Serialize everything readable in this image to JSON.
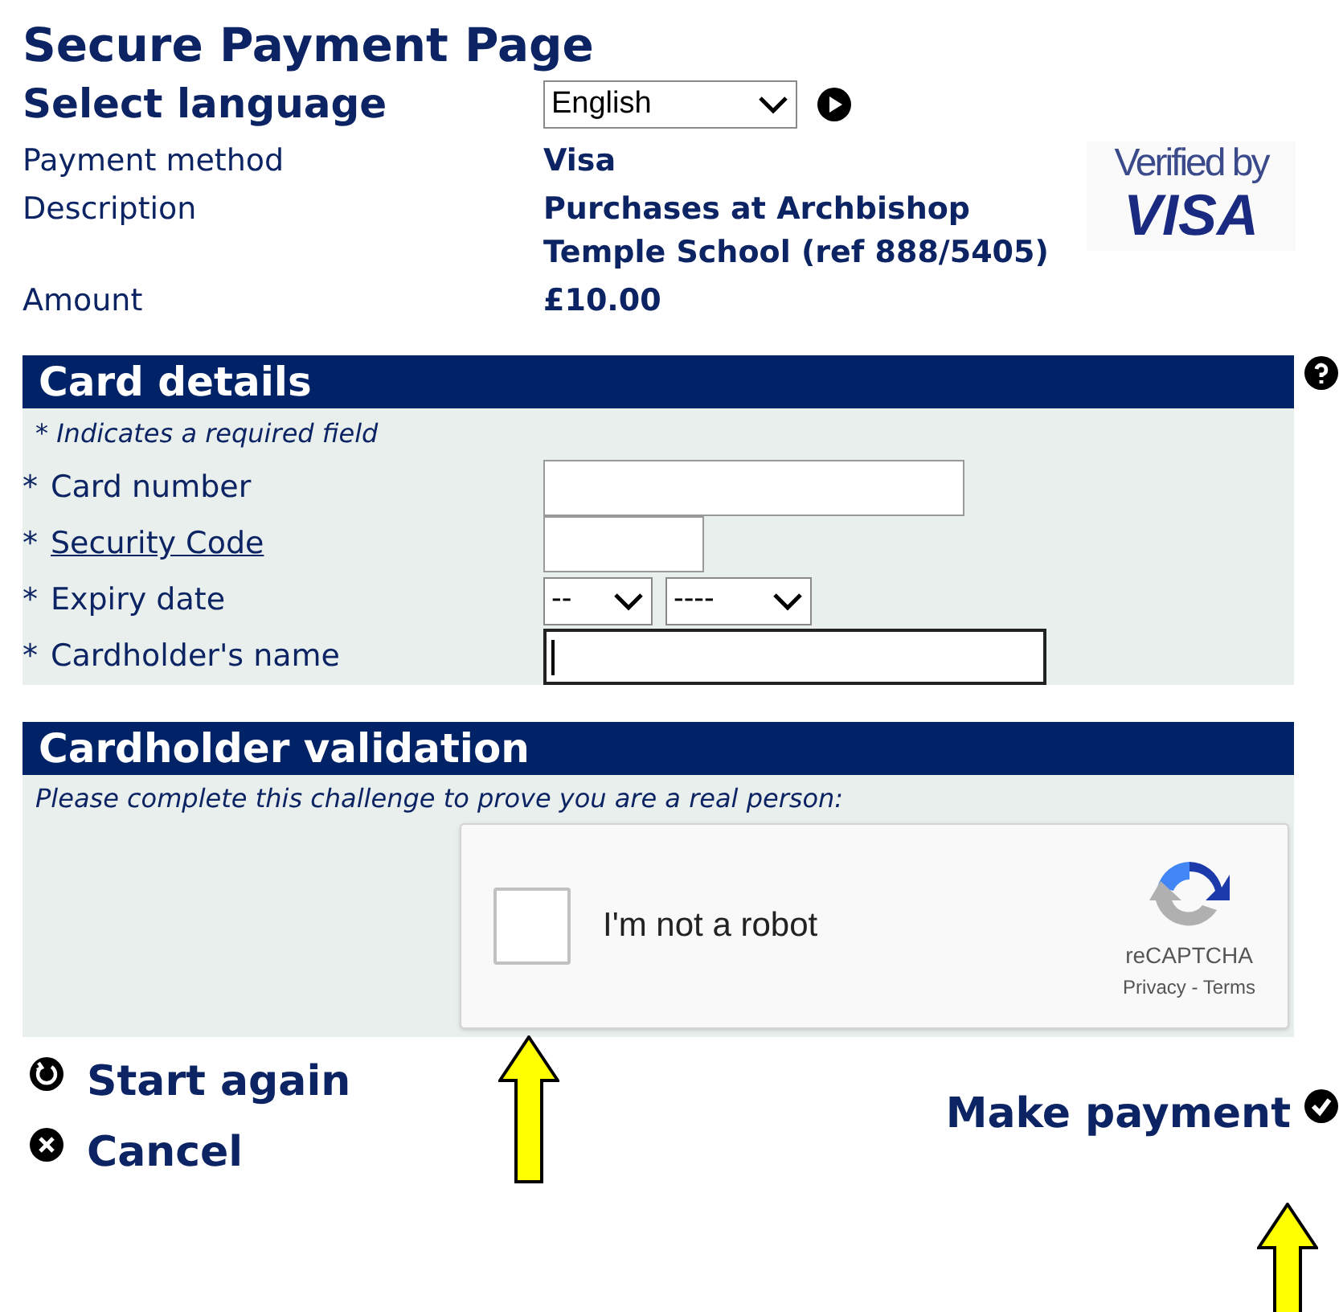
{
  "title": "Secure Payment Page",
  "language": {
    "label": "Select language",
    "value": "English"
  },
  "summary": [
    {
      "label": "Payment method",
      "value": "Visa"
    },
    {
      "label": "Description",
      "value": "Purchases at Archbishop Temple School (ref 888/5405)"
    },
    {
      "label": "Amount",
      "value": "£10.00"
    }
  ],
  "logo": {
    "line1": "Verified by",
    "line2": "VISA"
  },
  "card_details": {
    "title": "Card details",
    "note": "* Indicates a required field",
    "fields": [
      {
        "kind": "number",
        "marker": "*",
        "label": "Card number",
        "link": false,
        "focused": false
      },
      {
        "kind": "code",
        "marker": "*",
        "label": "Security Code",
        "link": true,
        "focused": false
      },
      {
        "kind": "expiry",
        "marker": "*",
        "label": "Expiry date",
        "link": false,
        "month": "--",
        "year": "----"
      },
      {
        "kind": "name",
        "marker": "*",
        "label": "Cardholder's name",
        "link": false,
        "focused": true
      }
    ]
  },
  "validation": {
    "title": "Cardholder validation",
    "note": "Please complete this challenge to prove you are a real person:",
    "captcha": {
      "label": "I'm not a robot",
      "checked": false,
      "brand": "reCAPTCHA",
      "privacy": "Privacy",
      "separator": " - ",
      "terms": "Terms"
    }
  },
  "actions": [
    {
      "kind": "restart",
      "label": "Start again"
    },
    {
      "kind": "cancel",
      "label": "Cancel"
    }
  ],
  "submit": {
    "label": "Make payment"
  }
}
